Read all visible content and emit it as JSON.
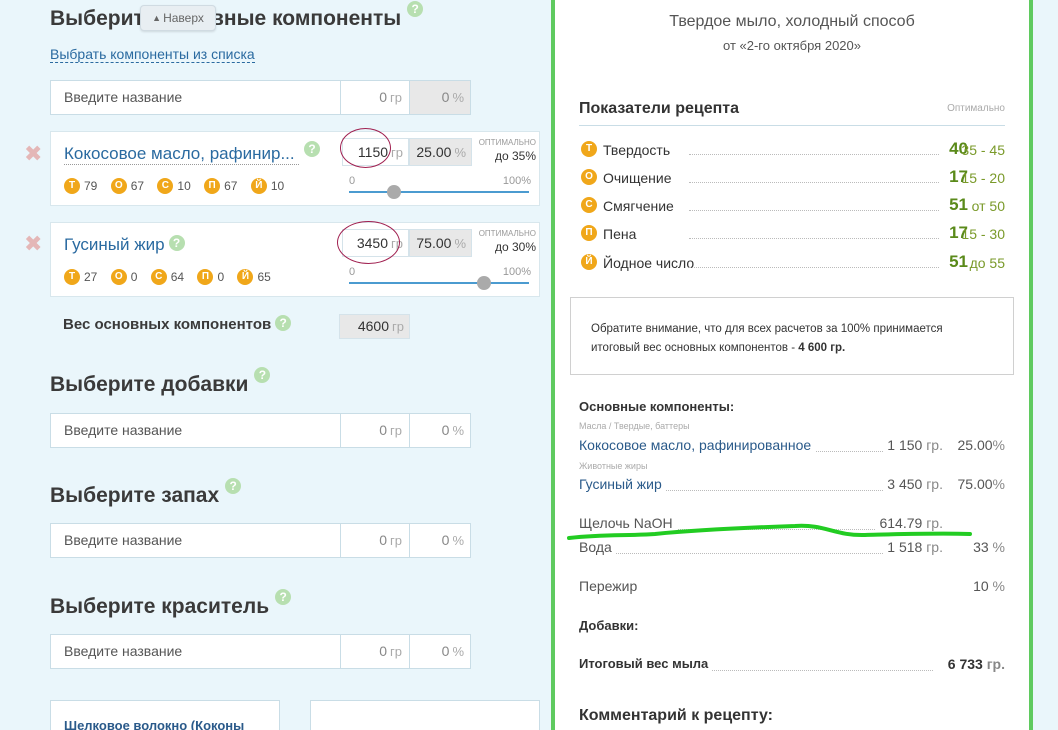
{
  "left": {
    "main_heading": "Выберите основные компоненты",
    "naverh_label": "Наверх",
    "select_link": "Выбрать компоненты из списка",
    "help_glyph": "?",
    "delete_glyph": "✖",
    "gr_unit": "гр",
    "pct_unit": "%",
    "slider_min": "0",
    "slider_max": "100%",
    "main_input": {
      "placeholder": "Введите название",
      "grams": "0",
      "percent": "0"
    },
    "components": [
      {
        "name": "Кокосовое масло, рафинир...",
        "grams": "1150",
        "percent": "25.00",
        "opt_label": "ОПТИМАЛЬНО",
        "opt_value": "до 35%",
        "slider_fraction": 0.25,
        "props": [
          {
            "letter": "Т",
            "value": "79"
          },
          {
            "letter": "О",
            "value": "67"
          },
          {
            "letter": "С",
            "value": "10"
          },
          {
            "letter": "П",
            "value": "67"
          },
          {
            "letter": "Й",
            "value": "10"
          }
        ]
      },
      {
        "name": "Гусиный жир",
        "grams": "3450",
        "percent": "75.00",
        "opt_label": "ОПТИМАЛЬНО",
        "opt_value": "до 30%",
        "slider_fraction": 0.75,
        "props": [
          {
            "letter": "Т",
            "value": "27"
          },
          {
            "letter": "О",
            "value": "0"
          },
          {
            "letter": "С",
            "value": "64"
          },
          {
            "letter": "П",
            "value": "0"
          },
          {
            "letter": "Й",
            "value": "65"
          }
        ]
      }
    ],
    "weight_label": "Вес основных компонентов",
    "weight_value": "4600",
    "additives": {
      "heading": "Выберите добавки",
      "placeholder": "Введите название",
      "grams": "0",
      "percent": "0"
    },
    "scent": {
      "heading": "Выберите запах",
      "placeholder": "Введите название",
      "grams": "0",
      "percent": "0"
    },
    "color": {
      "heading": "Выберите краситель",
      "placeholder": "Введите название",
      "grams": "0",
      "percent": "0"
    },
    "card1_title": "Шелковое волокно (Коконы"
  },
  "right": {
    "title": "Твердое мыло, холодный способ",
    "subtitle": "от «2-го октября 2020»",
    "indicators_heading": "Показатели рецепта",
    "indicators_optimal": "Оптимально",
    "indicators": [
      {
        "letter": "Т",
        "label": "Твердость",
        "value": "40",
        "range": "35 - 45"
      },
      {
        "letter": "О",
        "label": "Очищение",
        "value": "17",
        "range": "15 - 20"
      },
      {
        "letter": "С",
        "label": "Смягчение",
        "value": "51",
        "range": "от 50"
      },
      {
        "letter": "П",
        "label": "Пена",
        "value": "17",
        "range": "15 - 30"
      },
      {
        "letter": "Й",
        "label": "Йодное число",
        "value": "51",
        "range": "до 55"
      }
    ],
    "note_text": "Обратите внимание, что для всех расчетов за 100% принимается итоговый вес основных компонентов - ",
    "note_bold": "4 600 гр.",
    "main_components_heading": "Основные компоненты:",
    "cat1": "Масла / Твердые, баттеры",
    "row1": {
      "name": "Кокосовое масло, рафинированное",
      "grams": "1 150",
      "percent": "25.00"
    },
    "cat2": "Животные жиры",
    "row2": {
      "name": "Гусиный жир",
      "grams": "3 450",
      "percent": "75.00"
    },
    "naoh": {
      "name": "Щелочь NaOH",
      "grams": "614.79"
    },
    "water": {
      "name": "Вода",
      "grams": "1 518",
      "percent": "33"
    },
    "overfat": {
      "name": "Пережир",
      "percent": "10"
    },
    "additives_heading": "Добавки:",
    "total_label": "Итоговый вес мыла",
    "total_value": "6 733",
    "gr_unit": "гр.",
    "pct_unit": "%",
    "comment_heading": "Комментарий к рецепту:"
  },
  "colors": {
    "badge": "#f0a71a",
    "accent_green": "#5fca5f",
    "link_blue": "#2a6aa0"
  }
}
